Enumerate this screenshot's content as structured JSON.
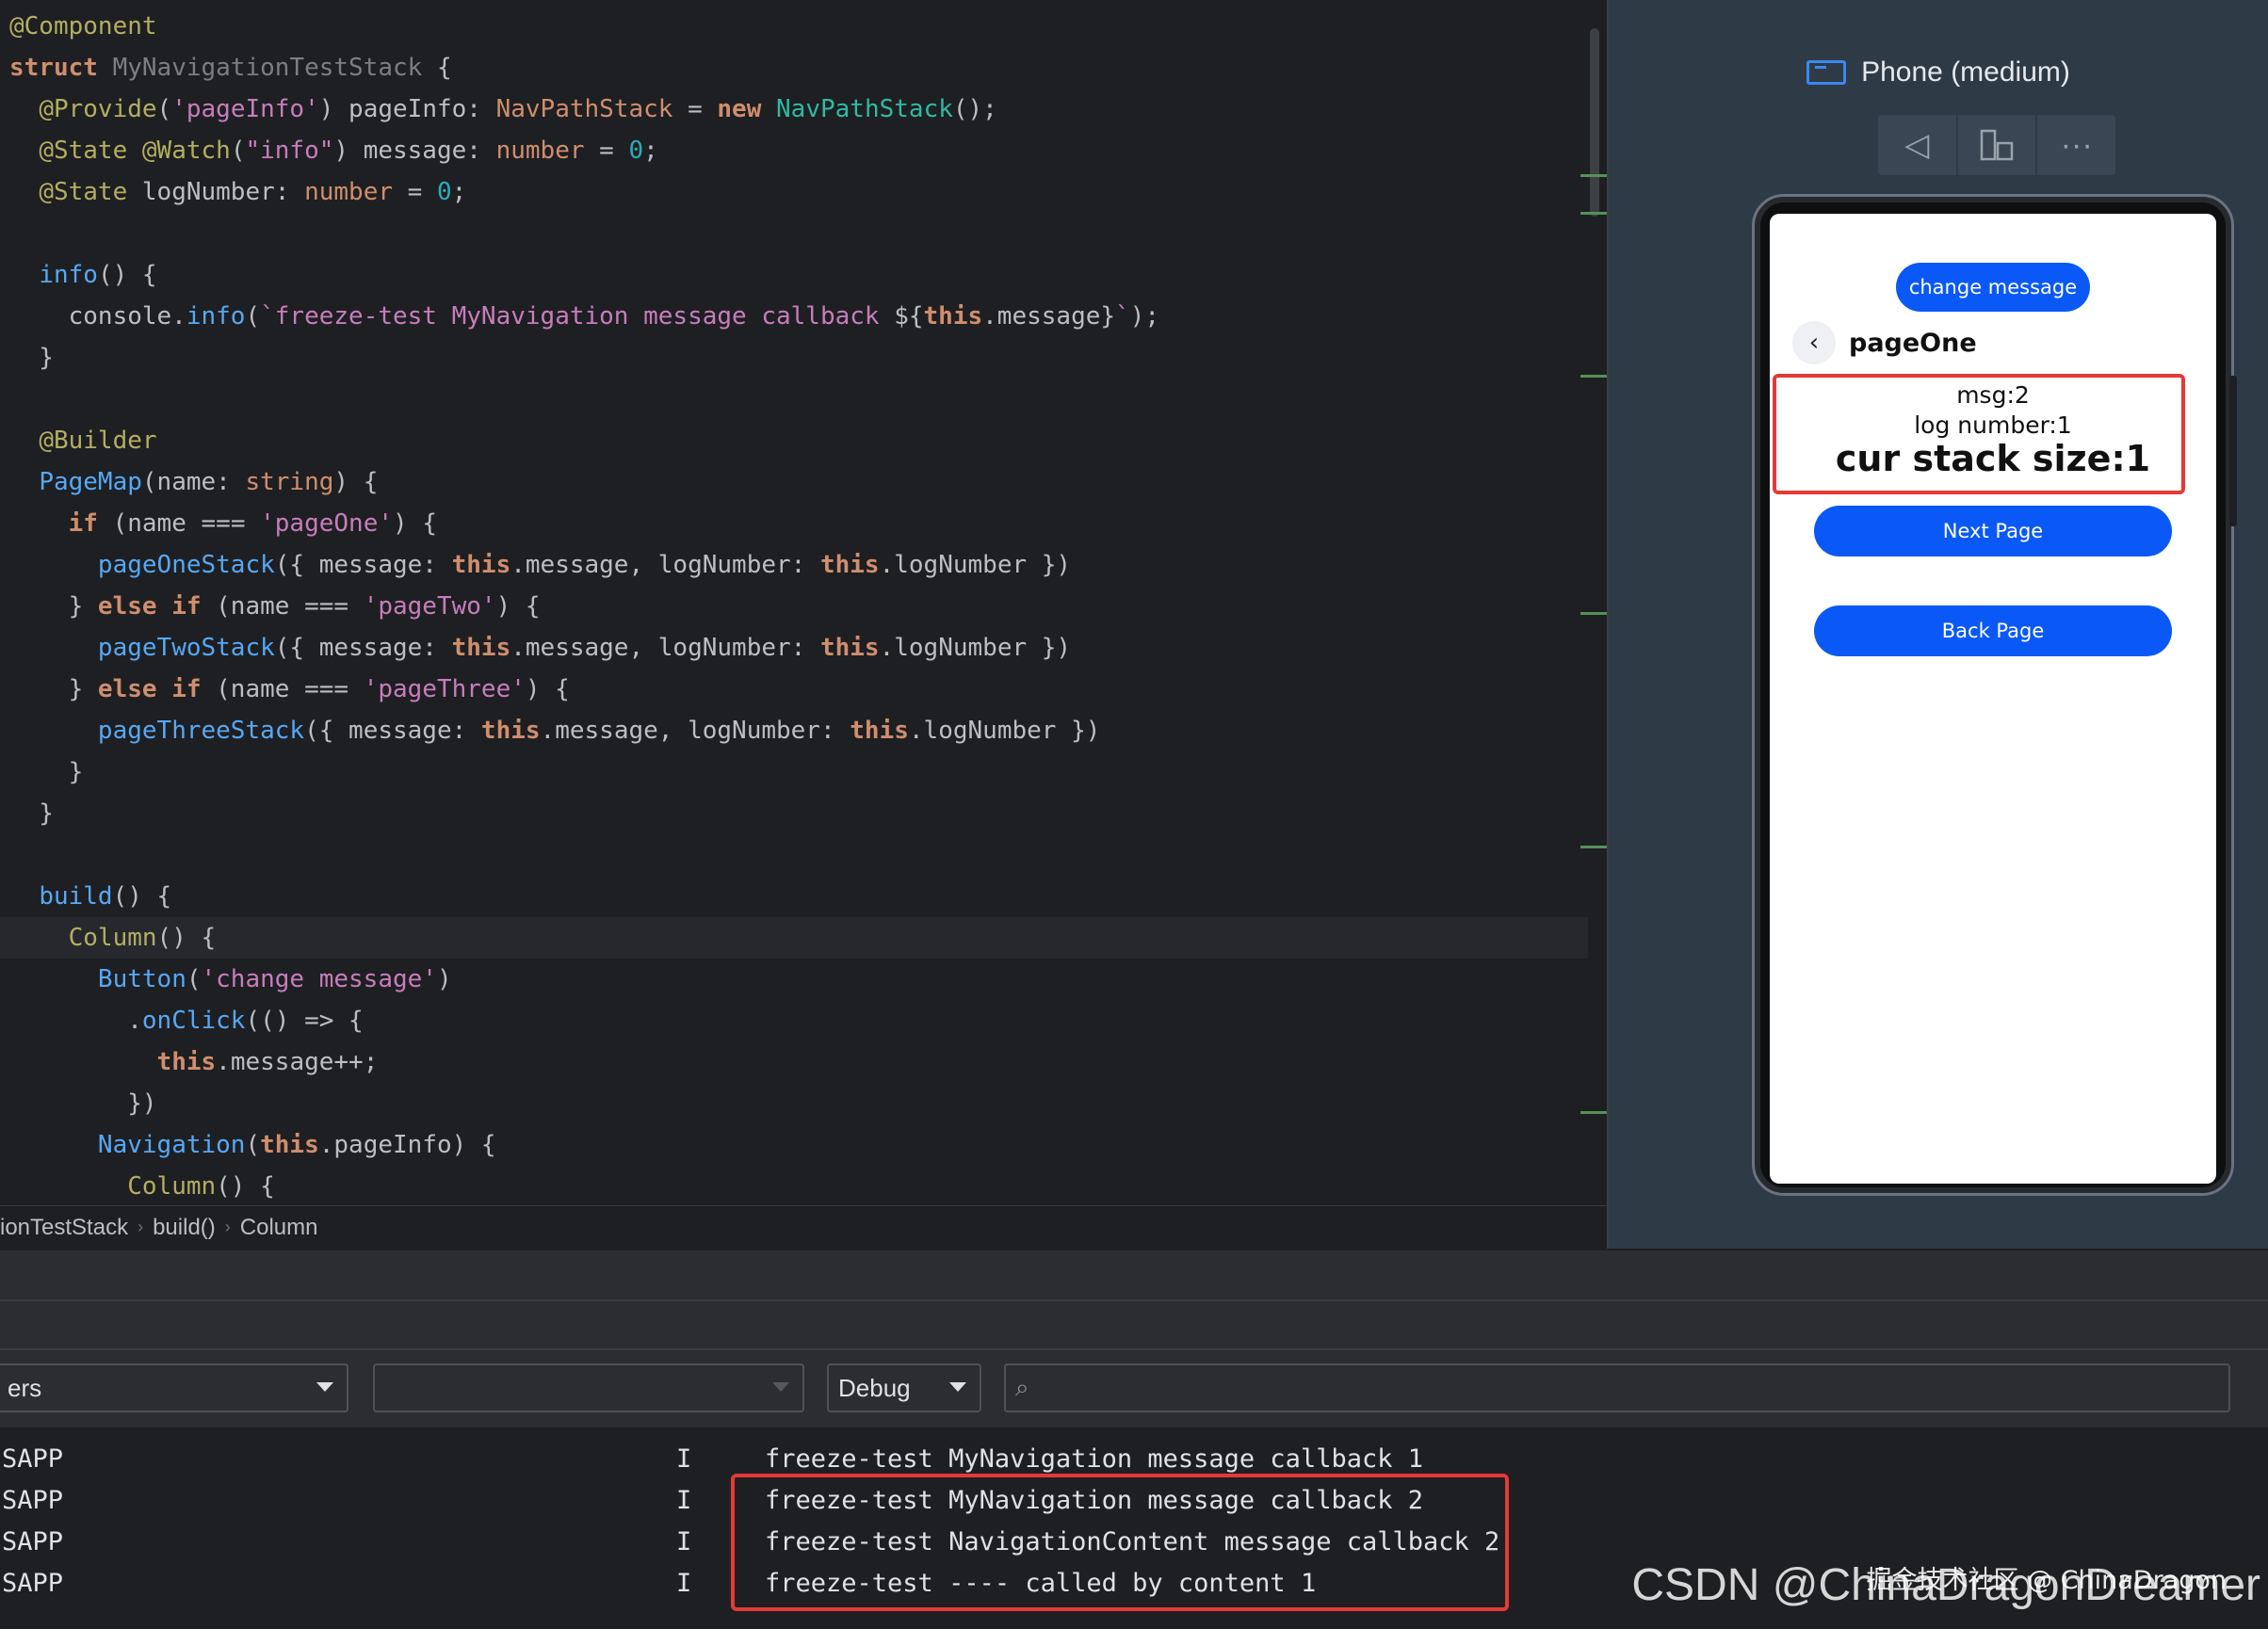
{
  "editor": {
    "lines": [
      [
        {
          "c": "tok-ann",
          "t": "@Component"
        }
      ],
      [
        {
          "c": "tok-kw",
          "t": "struct "
        },
        {
          "c": "tok-gray",
          "t": "MyNavigationTestStack "
        },
        {
          "c": "tok-pl",
          "t": "{"
        }
      ],
      [
        {
          "c": "tok-pl",
          "t": "  "
        },
        {
          "c": "tok-ann",
          "t": "@Provide"
        },
        {
          "c": "tok-pl",
          "t": "("
        },
        {
          "c": "tok-strp",
          "t": "'pageInfo'"
        },
        {
          "c": "tok-pl",
          "t": ") pageInfo: "
        },
        {
          "c": "tok-type",
          "t": "NavPathStack"
        },
        {
          "c": "tok-pl",
          "t": " = "
        },
        {
          "c": "tok-kw",
          "t": "new "
        },
        {
          "c": "tok-cls",
          "t": "NavPathStack"
        },
        {
          "c": "tok-pl",
          "t": "();"
        }
      ],
      [
        {
          "c": "tok-pl",
          "t": "  "
        },
        {
          "c": "tok-ann",
          "t": "@State @Watch"
        },
        {
          "c": "tok-pl",
          "t": "("
        },
        {
          "c": "tok-strp",
          "t": "\"info\""
        },
        {
          "c": "tok-pl",
          "t": ") message: "
        },
        {
          "c": "tok-type",
          "t": "number"
        },
        {
          "c": "tok-pl",
          "t": " = "
        },
        {
          "c": "tok-num",
          "t": "0"
        },
        {
          "c": "tok-pl",
          "t": ";"
        }
      ],
      [
        {
          "c": "tok-pl",
          "t": "  "
        },
        {
          "c": "tok-ann",
          "t": "@State"
        },
        {
          "c": "tok-pl",
          "t": " logNumber: "
        },
        {
          "c": "tok-type",
          "t": "number"
        },
        {
          "c": "tok-pl",
          "t": " = "
        },
        {
          "c": "tok-num",
          "t": "0"
        },
        {
          "c": "tok-pl",
          "t": ";"
        }
      ],
      [],
      [
        {
          "c": "tok-pl",
          "t": "  "
        },
        {
          "c": "tok-fn",
          "t": "info"
        },
        {
          "c": "tok-pl",
          "t": "() {"
        }
      ],
      [
        {
          "c": "tok-pl",
          "t": "    console."
        },
        {
          "c": "tok-fn",
          "t": "info"
        },
        {
          "c": "tok-pl",
          "t": "("
        },
        {
          "c": "tok-strp",
          "t": "`freeze-test MyNavigation message callback "
        },
        {
          "c": "tok-pl",
          "t": "${"
        },
        {
          "c": "tok-this",
          "t": "this"
        },
        {
          "c": "tok-pl",
          "t": ".message}"
        },
        {
          "c": "tok-strp",
          "t": "`"
        },
        {
          "c": "tok-pl",
          "t": ");"
        }
      ],
      [
        {
          "c": "tok-pl",
          "t": "  }"
        }
      ],
      [],
      [
        {
          "c": "tok-pl",
          "t": "  "
        },
        {
          "c": "tok-ann",
          "t": "@Builder"
        }
      ],
      [
        {
          "c": "tok-pl",
          "t": "  "
        },
        {
          "c": "tok-fn",
          "t": "PageMap"
        },
        {
          "c": "tok-pl",
          "t": "(name: "
        },
        {
          "c": "tok-type",
          "t": "string"
        },
        {
          "c": "tok-pl",
          "t": ") {"
        }
      ],
      [
        {
          "c": "tok-pl",
          "t": "    "
        },
        {
          "c": "tok-kw",
          "t": "if"
        },
        {
          "c": "tok-pl",
          "t": " (name === "
        },
        {
          "c": "tok-strp",
          "t": "'pageOne'"
        },
        {
          "c": "tok-pl",
          "t": ") {"
        }
      ],
      [
        {
          "c": "tok-pl",
          "t": "      "
        },
        {
          "c": "tok-fn",
          "t": "pageOneStack"
        },
        {
          "c": "tok-pl",
          "t": "({ message: "
        },
        {
          "c": "tok-this",
          "t": "this"
        },
        {
          "c": "tok-pl",
          "t": ".message, logNumber: "
        },
        {
          "c": "tok-this",
          "t": "this"
        },
        {
          "c": "tok-pl",
          "t": ".logNumber })"
        }
      ],
      [
        {
          "c": "tok-pl",
          "t": "    } "
        },
        {
          "c": "tok-kw",
          "t": "else if"
        },
        {
          "c": "tok-pl",
          "t": " (name === "
        },
        {
          "c": "tok-strp",
          "t": "'pageTwo'"
        },
        {
          "c": "tok-pl",
          "t": ") {"
        }
      ],
      [
        {
          "c": "tok-pl",
          "t": "      "
        },
        {
          "c": "tok-fn",
          "t": "pageTwoStack"
        },
        {
          "c": "tok-pl",
          "t": "({ message: "
        },
        {
          "c": "tok-this",
          "t": "this"
        },
        {
          "c": "tok-pl",
          "t": ".message, logNumber: "
        },
        {
          "c": "tok-this",
          "t": "this"
        },
        {
          "c": "tok-pl",
          "t": ".logNumber })"
        }
      ],
      [
        {
          "c": "tok-pl",
          "t": "    } "
        },
        {
          "c": "tok-kw",
          "t": "else if"
        },
        {
          "c": "tok-pl",
          "t": " (name === "
        },
        {
          "c": "tok-strp",
          "t": "'pageThree'"
        },
        {
          "c": "tok-pl",
          "t": ") {"
        }
      ],
      [
        {
          "c": "tok-pl",
          "t": "      "
        },
        {
          "c": "tok-fn",
          "t": "pageThreeStack"
        },
        {
          "c": "tok-pl",
          "t": "({ message: "
        },
        {
          "c": "tok-this",
          "t": "this"
        },
        {
          "c": "tok-pl",
          "t": ".message, logNumber: "
        },
        {
          "c": "tok-this",
          "t": "this"
        },
        {
          "c": "tok-pl",
          "t": ".logNumber })"
        }
      ],
      [
        {
          "c": "tok-pl",
          "t": "    }"
        }
      ],
      [
        {
          "c": "tok-pl",
          "t": "  }"
        }
      ],
      [],
      [
        {
          "c": "tok-pl",
          "t": "  "
        },
        {
          "c": "tok-fn",
          "t": "build"
        },
        {
          "c": "tok-pl",
          "t": "() {"
        }
      ],
      [
        {
          "c": "tok-pl",
          "t": "    "
        },
        {
          "c": "tok-ann",
          "t": "Column"
        },
        {
          "c": "tok-pl",
          "t": "() {"
        }
      ],
      [
        {
          "c": "tok-pl",
          "t": "      "
        },
        {
          "c": "tok-fn",
          "t": "Button"
        },
        {
          "c": "tok-pl",
          "t": "("
        },
        {
          "c": "tok-strp",
          "t": "'change message'"
        },
        {
          "c": "tok-pl",
          "t": ")"
        }
      ],
      [
        {
          "c": "tok-pl",
          "t": "        ."
        },
        {
          "c": "tok-fn",
          "t": "onClick"
        },
        {
          "c": "tok-pl",
          "t": "(() => {"
        }
      ],
      [
        {
          "c": "tok-pl",
          "t": "          "
        },
        {
          "c": "tok-this",
          "t": "this"
        },
        {
          "c": "tok-pl",
          "t": ".message++;"
        }
      ],
      [
        {
          "c": "tok-pl",
          "t": "        })"
        }
      ],
      [
        {
          "c": "tok-pl",
          "t": "      "
        },
        {
          "c": "tok-fn",
          "t": "Navigation"
        },
        {
          "c": "tok-pl",
          "t": "("
        },
        {
          "c": "tok-this",
          "t": "this"
        },
        {
          "c": "tok-pl",
          "t": ".pageInfo) {"
        }
      ],
      [
        {
          "c": "tok-pl",
          "t": "        "
        },
        {
          "c": "tok-ann",
          "t": "Column"
        },
        {
          "c": "tok-pl",
          "t": "() {"
        }
      ]
    ],
    "current_line": 22
  },
  "breadcrumb": [
    "ionTestStack",
    "build()",
    "Column"
  ],
  "preview": {
    "device_title": "Phone (medium)",
    "toolbar": [
      {
        "icon": "back-triangle-icon",
        "glyph": "◁"
      },
      {
        "icon": "rotate-device-icon",
        "glyph": "⫽"
      },
      {
        "icon": "more-icon",
        "glyph": "···"
      }
    ],
    "screen": {
      "change_button": "change message",
      "back_glyph": "‹",
      "nav_title": "pageOne",
      "msg": "msg:2",
      "log_number": "log number:1",
      "stack_size": "cur stack size:1",
      "next_button": "Next Page",
      "back_button": "Back Page"
    }
  },
  "log_panel": {
    "filter1": "ers",
    "filter2": "",
    "level": "Debug",
    "search_placeholder": "",
    "rows": [
      {
        "tag": "SAPP",
        "level": "I",
        "msg": "freeze-test MyNavigation message callback 1"
      },
      {
        "tag": "SAPP",
        "level": "I",
        "msg": "freeze-test MyNavigation message callback 2"
      },
      {
        "tag": "SAPP",
        "level": "I",
        "msg": "freeze-test NavigationContent message callback 2"
      },
      {
        "tag": "SAPP",
        "level": "I",
        "msg": "freeze-test ---- called by content 1"
      }
    ]
  },
  "watermark": {
    "main": "CSDN @ChinaDragonDreamer",
    "sub": "掘金技术社区 @ ChinaDragon"
  },
  "colors": {
    "accent": "#0a59f7",
    "highlight_box": "#e53935",
    "editor_bg": "#1e1f22",
    "preview_bg": "#2f3a47"
  }
}
